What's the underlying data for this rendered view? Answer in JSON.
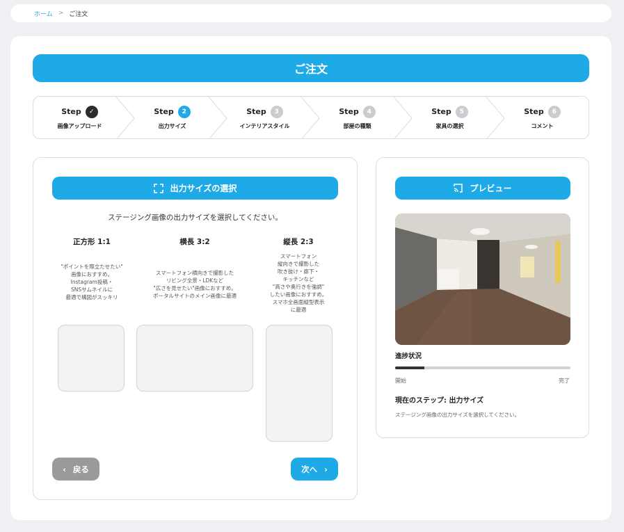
{
  "breadcrumb": {
    "home": "ホーム",
    "sep": ">",
    "current": "ご注文"
  },
  "page_title": "ご注文",
  "steps": [
    {
      "step_text": "Step",
      "badge": "✓",
      "label": "画像アップロード",
      "state": "done"
    },
    {
      "step_text": "Step",
      "badge": "2",
      "label": "出力サイズ",
      "state": "current"
    },
    {
      "step_text": "Step",
      "badge": "3",
      "label": "インテリアスタイル",
      "state": "todo"
    },
    {
      "step_text": "Step",
      "badge": "4",
      "label": "部屋の種類",
      "state": "todo"
    },
    {
      "step_text": "Step",
      "badge": "5",
      "label": "家具の選択",
      "state": "todo"
    },
    {
      "step_text": "Step",
      "badge": "6",
      "label": "コメント",
      "state": "todo"
    }
  ],
  "size_section": {
    "header": "出力サイズの選択",
    "icon": "expand-icon",
    "instruction": "ステージング画像の出力サイズを選択してください。",
    "options": [
      {
        "title": "正方形 1:1",
        "desc": "\"ポイントを際立たせたい\"\n画像におすすめ。\nInstagram投稿・\nSNSサムネイルに\n最適で構図がスッキリ"
      },
      {
        "title": "横長 3:2",
        "desc": "スマートフォン横向きで撮影した\nリビング全景・LDKなど\n\"広さを見せたい\"画像におすすめ。\nポータルサイトのメイン画像に最適"
      },
      {
        "title": "縦長 2:3",
        "desc": "スマートフォン\n縦向きで撮影した\n吹き抜け・廊下・\nキッチンなど\n\"高さや奥行きを強調\"\nしたい画像におすすめ。\nスマホ全画面縦型表示\nに最適"
      }
    ],
    "back_label": "戻る",
    "next_label": "次へ"
  },
  "preview": {
    "header": "プレビュー",
    "icon": "cast-icon",
    "progress_label": "進捗状況",
    "progress_value": 0.167,
    "start_label": "開始",
    "end_label": "完了",
    "current_step": "現在のステップ: 出力サイズ",
    "current_desc": "ステージング画像の出力サイズを選択してください。"
  },
  "colors": {
    "accent": "#1eaae7",
    "done": "#2b2b2b",
    "todo": "#c9cdd2",
    "back": "#9a9a9a"
  }
}
